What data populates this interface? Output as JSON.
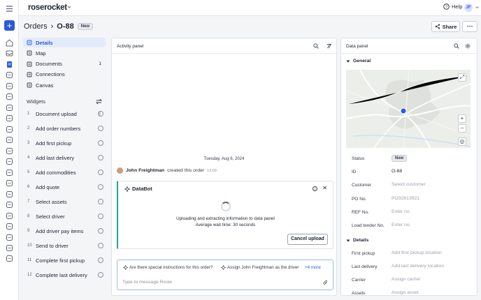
{
  "app": {
    "brand": "roserocket",
    "help": "Help",
    "avatar_initial": "JF"
  },
  "rail": {
    "icons": [
      "home-icon",
      "inbox-icon",
      "orders-icon",
      "grid-icon",
      "calendar-icon",
      "invoice-icon",
      "shipment-icon",
      "document-icon",
      "box-icon",
      "globe-icon",
      "lock-icon",
      "people-icon",
      "dollar-icon",
      "truck-icon",
      "customer-icon",
      "route-icon",
      "warehouse-icon",
      "team-icon",
      "report-icon",
      "analytics-icon",
      "settings-icon",
      "world-icon"
    ]
  },
  "header": {
    "breadcrumb": "Orders",
    "separator": "›",
    "order_id": "O-88",
    "status": "New",
    "share": "Share",
    "more": "⋯"
  },
  "nav": {
    "items": [
      {
        "label": "Details",
        "icon": "details-icon",
        "count": ""
      },
      {
        "label": "Map",
        "icon": "map-icon",
        "count": ""
      },
      {
        "label": "Documents",
        "icon": "documents-icon",
        "count": "1"
      },
      {
        "label": "Connections",
        "icon": "connections-icon",
        "count": ""
      },
      {
        "label": "Canvas",
        "icon": "canvas-icon",
        "count": ""
      }
    ],
    "widgets_title": "Widgets",
    "widgets": [
      {
        "num": "1",
        "label": "Document upload",
        "state": "in-progress"
      },
      {
        "num": "2",
        "label": "Add order numbers",
        "state": "todo"
      },
      {
        "num": "3",
        "label": "Add first pickup",
        "state": "todo"
      },
      {
        "num": "4",
        "label": "Add last delivery",
        "state": "todo"
      },
      {
        "num": "5",
        "label": "Add commodities",
        "state": "todo"
      },
      {
        "num": "6",
        "label": "Add quote",
        "state": "todo"
      },
      {
        "num": "7",
        "label": "Select assets",
        "state": "todo"
      },
      {
        "num": "8",
        "label": "Select driver",
        "state": "todo"
      },
      {
        "num": "9",
        "label": "Add driver pay items",
        "state": "todo"
      },
      {
        "num": "10",
        "label": "Send to driver",
        "state": "todo"
      },
      {
        "num": "11",
        "label": "Complete first pickup",
        "state": "todo"
      },
      {
        "num": "12",
        "label": "Complete last delivery",
        "state": "todo"
      }
    ]
  },
  "activity": {
    "title": "Activity panel",
    "date": "Tuesday, Aug 6, 2024",
    "event": {
      "user": "John Freightman",
      "action": "created this order",
      "time": "13:00"
    },
    "databot": {
      "title": "DataBot",
      "line1": "Uploading and extracting information to data panel",
      "line2": "Average wait time: 30 seconds",
      "cancel": "Cancel upload"
    },
    "suggestions": [
      "Are there special instructions for this order?",
      "Assign John Freightman as the driver"
    ],
    "more_suggestions": "+4 more",
    "placeholder": "Type to message Rosie"
  },
  "data_panel": {
    "title": "Data panel",
    "general_title": "General",
    "fields": [
      {
        "label": "Status",
        "value": "New",
        "kind": "pill"
      },
      {
        "label": "ID",
        "value": "O-88",
        "kind": "value"
      },
      {
        "label": "Customer",
        "value": "Select customer",
        "kind": "placeholder"
      },
      {
        "label": "PO No.",
        "value": "PO32813921",
        "kind": "placeholder"
      },
      {
        "label": "REF No.",
        "value": "Enter no.",
        "kind": "placeholder"
      },
      {
        "label": "Load tender No.",
        "value": "Enter no.",
        "kind": "placeholder"
      }
    ],
    "details_title": "Details",
    "details": [
      {
        "label": "First pickup",
        "value": "Add first pickup location"
      },
      {
        "label": "Last delivery",
        "value": "Add last delivery location"
      },
      {
        "label": "Carrier",
        "value": "Assign carrier"
      },
      {
        "label": "Assets",
        "value": "Assign asset"
      }
    ],
    "map_controls": {
      "zoom_in": "+",
      "zoom_out": "−"
    }
  },
  "colors": {
    "accent": "#2a5bd7",
    "databot_border": "#20a39e",
    "active_nav_bg": "#e3ebfb"
  }
}
